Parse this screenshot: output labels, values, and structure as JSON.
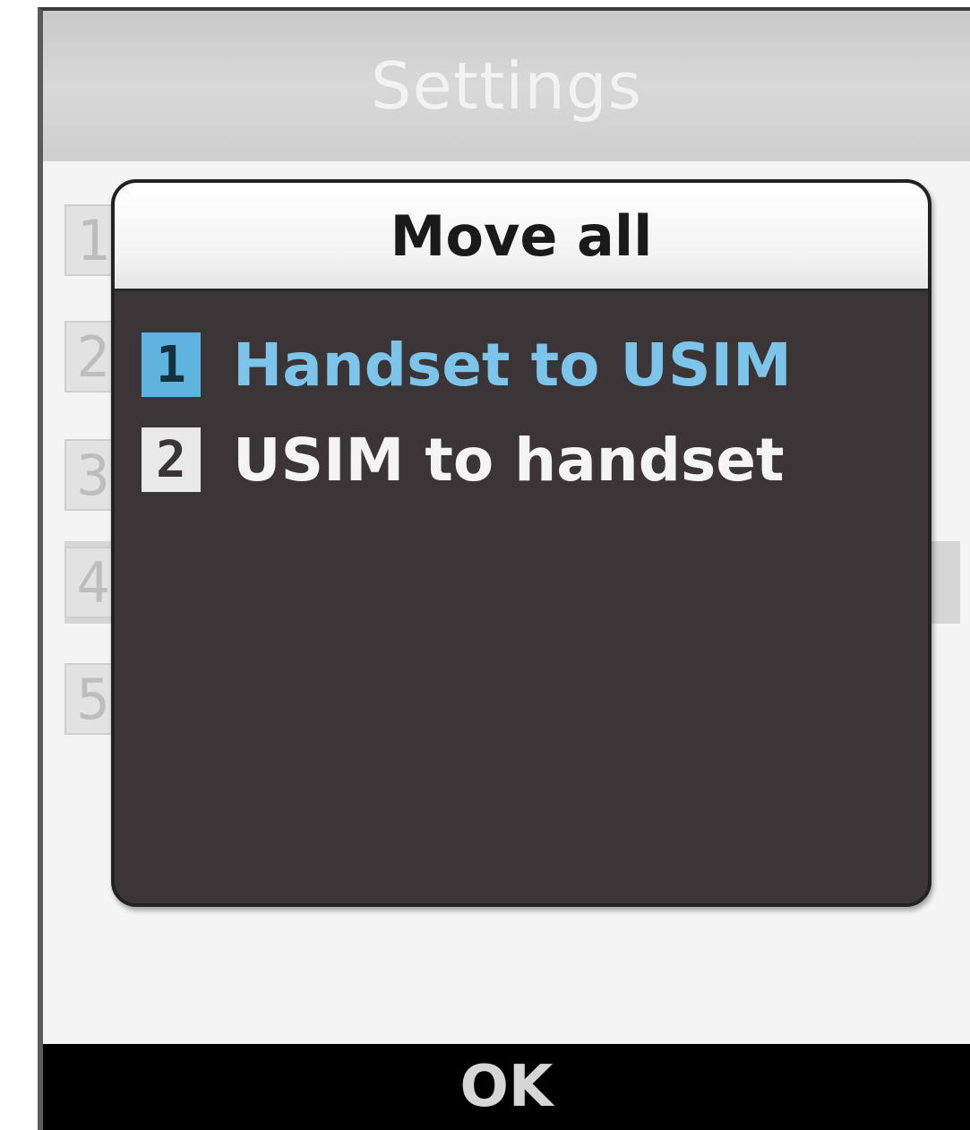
{
  "header": {
    "title": "Settings"
  },
  "background_list": {
    "numbers": [
      "1",
      "2",
      "3",
      "4",
      "5"
    ]
  },
  "popup": {
    "title": "Move all",
    "options": [
      {
        "number": "1",
        "label": "Handset to USIM",
        "selected": true
      },
      {
        "number": "2",
        "label": "USIM to handset",
        "selected": false
      }
    ]
  },
  "softkey": {
    "center_label": "OK"
  },
  "colors": {
    "selected_text": "#7cc4ea",
    "selected_badge": "#5fb3df",
    "popup_background": "#3b3538",
    "softkey_bar": "#000000"
  }
}
